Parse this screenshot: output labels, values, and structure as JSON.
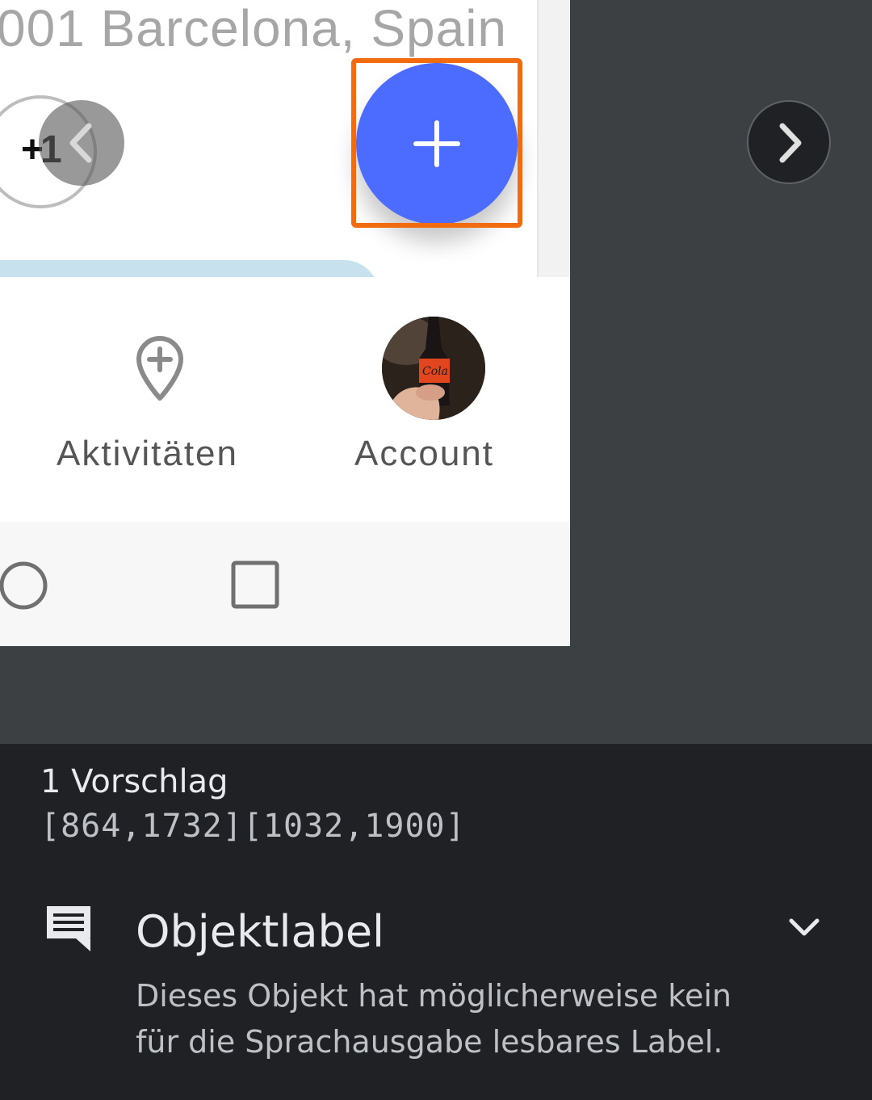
{
  "app": {
    "address_text": "001 Barcelona, Spain",
    "plus_badge": "+1",
    "fab_icon": "plus-icon",
    "fab_color": "#4c6bff",
    "highlight_color": "#f26b0f",
    "nav": {
      "activities_label": "Aktivitäten",
      "account_label": "Account"
    }
  },
  "panel": {
    "suggestion_count": "1 Vorschlag",
    "bounds": "[864,1732][1032,1900]",
    "issue_title": "Objektlabel",
    "issue_description": "Dieses Objekt hat möglicherweise kein für die Sprachausgabe lesbares Label."
  },
  "icons": {
    "prev": "chevron-left-icon",
    "next": "chevron-right-icon",
    "activities": "map-pin-plus-icon",
    "comment": "comment-icon",
    "expand": "chevron-down-icon",
    "home": "circle-home-icon",
    "recents": "square-recents-icon"
  }
}
